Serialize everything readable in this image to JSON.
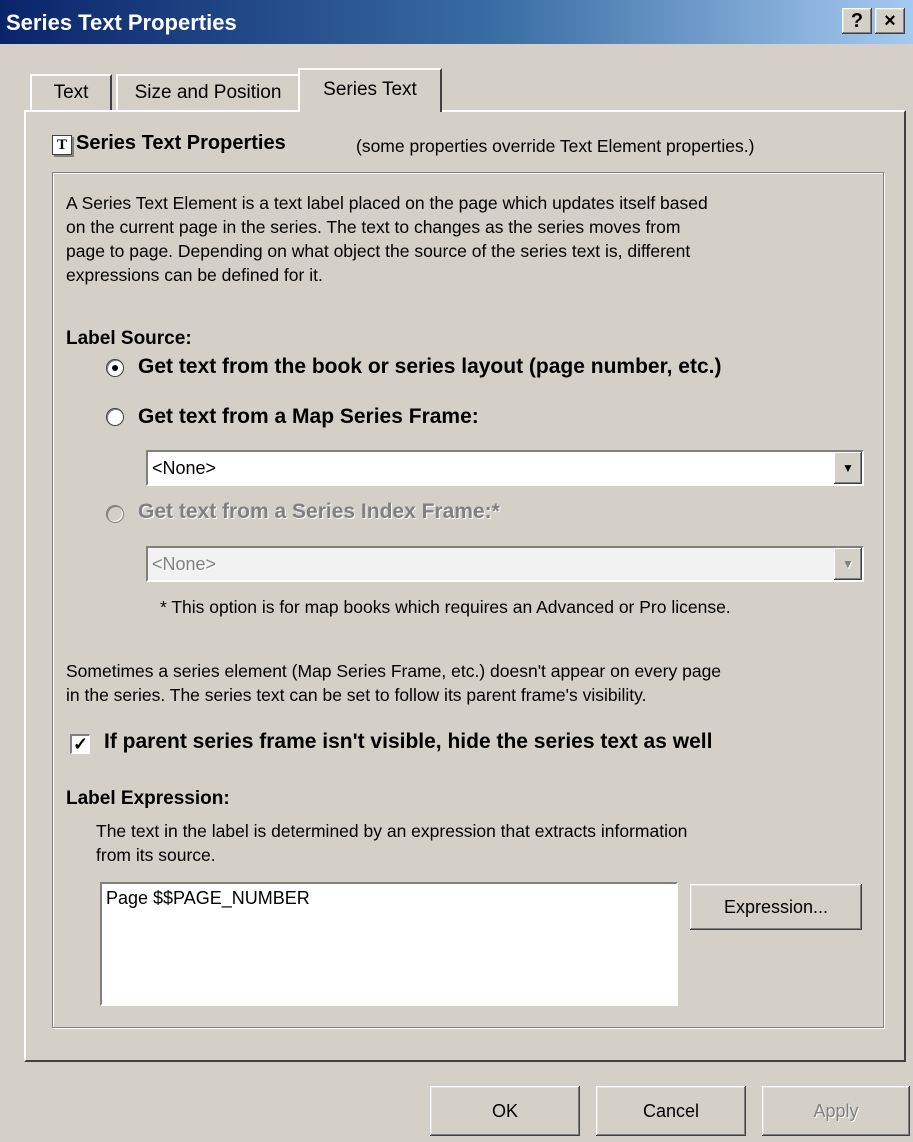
{
  "window": {
    "title": "Series Text Properties",
    "help_btn": "?",
    "close_btn": "×"
  },
  "tabs": [
    {
      "label": "Text"
    },
    {
      "label": "Size and Position"
    },
    {
      "label": "Series Text",
      "active": true
    }
  ],
  "header": {
    "title": "Series Text Properties",
    "note": "(some properties override Text Element properties.)",
    "icon": "text-element-icon"
  },
  "description": {
    "lines": [
      "A Series Text Element is a text label placed on the page which updates itself based",
      "on the current page in the series.  The text to changes as the series moves from",
      "page to page.  Depending on what object the source of the series text is, different",
      "expressions can be defined for it."
    ]
  },
  "label_source": {
    "heading": "Label Source:",
    "options": [
      {
        "label": "Get text from the book or series layout  (page number, etc.)",
        "checked": true,
        "enabled": true
      },
      {
        "label": "Get text from a Map Series Frame:",
        "checked": false,
        "enabled": true
      },
      {
        "label": "Get text from a Series Index Frame:*",
        "checked": false,
        "enabled": false
      }
    ],
    "map_series_combo": "<None>",
    "index_frame_combo": "<None>",
    "license_note": "* This option is for map books which requires an Advanced or Pro license."
  },
  "visibility": {
    "lines": [
      "Sometimes a series element (Map Series Frame, etc.) doesn't appear on every page",
      "in the series.  The series text can be set to follow its parent frame's visibility."
    ],
    "checkbox_label": "If parent series frame isn't visible, hide the series text as well",
    "checkbox_checked": true,
    "check_mark": "✓"
  },
  "label_expression": {
    "heading": "Label Expression:",
    "lines": [
      "The text in the label is determined by an expression that extracts information",
      "from its source."
    ],
    "value": "Page $$PAGE_NUMBER",
    "button": "Expression..."
  },
  "footer": {
    "ok": "OK",
    "cancel": "Cancel",
    "apply": "Apply"
  },
  "colors": {
    "dialog_bg": "#d4d0c8",
    "title_start": "#0a246a",
    "title_end": "#a6caf0"
  }
}
